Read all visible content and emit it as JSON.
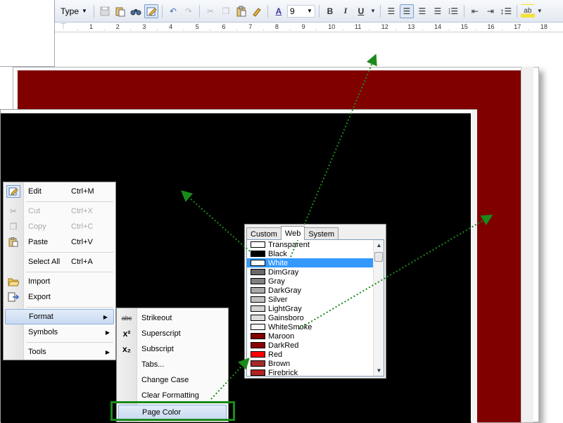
{
  "toolbar": {
    "style_combo": "Type",
    "font_size": "9",
    "icons": [
      "save-icon",
      "paste-special-icon",
      "find-icon",
      "edit-page-icon",
      "undo-icon",
      "redo-icon",
      "cut-icon",
      "copy-icon",
      "paste-icon",
      "format-painter-icon",
      "font-color-icon",
      "bold-icon",
      "italic-icon",
      "underline-icon",
      "align-justify-icon",
      "align-left-icon",
      "align-center-icon",
      "align-right-icon",
      "bullets-icon",
      "decrease-indent-icon",
      "increase-indent-icon",
      "line-spacing-icon",
      "highlight-icon"
    ],
    "bold": "B",
    "italic": "I",
    "underline": "U",
    "font_color_glyph": "A",
    "highlight_glyph": "ab"
  },
  "ruler": {
    "numbers": [
      "1",
      "2",
      "3",
      "4",
      "5",
      "6",
      "7",
      "8",
      "9",
      "10",
      "11",
      "12",
      "13",
      "14",
      "15",
      "16",
      "17",
      "18"
    ]
  },
  "context_menu": {
    "items": [
      {
        "label": "Edit",
        "shortcut": "Ctrl+M",
        "icon": "edit-page-icon",
        "enabled": true
      },
      {
        "label": "Cut",
        "shortcut": "Ctrl+X",
        "icon": "cut-icon",
        "enabled": false
      },
      {
        "label": "Copy",
        "shortcut": "Ctrl+C",
        "icon": "copy-icon",
        "enabled": false
      },
      {
        "label": "Paste",
        "shortcut": "Ctrl+V",
        "icon": "paste-icon",
        "enabled": true
      },
      {
        "label": "Select All",
        "shortcut": "Ctrl+A",
        "enabled": true
      },
      {
        "label": "Import",
        "icon": "open-folder-icon",
        "enabled": true
      },
      {
        "label": "Export",
        "icon": "export-icon",
        "enabled": true
      },
      {
        "label": "Format",
        "submenu": true,
        "highlighted": true
      },
      {
        "label": "Symbols",
        "submenu": true
      },
      {
        "label": "Tools",
        "submenu": true
      }
    ]
  },
  "format_submenu": {
    "items": [
      {
        "label": "Strikeout",
        "icon": "strikeout-icon",
        "glyph": "abc"
      },
      {
        "label": "Superscript",
        "icon": "superscript-icon",
        "glyph": "x²"
      },
      {
        "label": "Subscript",
        "icon": "subscript-icon",
        "glyph": "x₂"
      },
      {
        "label": "Tabs..."
      },
      {
        "label": "Change Case"
      },
      {
        "label": "Clear Formatting"
      },
      {
        "label": "Page Color",
        "highlighted": true
      }
    ]
  },
  "color_picker": {
    "tabs": [
      "Custom",
      "Web",
      "System"
    ],
    "active_tab": "Web",
    "selected": "White",
    "colors": [
      {
        "name": "Transparent",
        "hex": "#ffffff"
      },
      {
        "name": "Black",
        "hex": "#000000"
      },
      {
        "name": "White",
        "hex": "#ffffff"
      },
      {
        "name": "DimGray",
        "hex": "#696969"
      },
      {
        "name": "Gray",
        "hex": "#808080"
      },
      {
        "name": "DarkGray",
        "hex": "#a9a9a9"
      },
      {
        "name": "Silver",
        "hex": "#c0c0c0"
      },
      {
        "name": "LightGray",
        "hex": "#d3d3d3"
      },
      {
        "name": "Gainsboro",
        "hex": "#dcdcdc"
      },
      {
        "name": "WhiteSmoke",
        "hex": "#f5f5f5"
      },
      {
        "name": "Maroon",
        "hex": "#800000"
      },
      {
        "name": "DarkRed",
        "hex": "#8b0000"
      },
      {
        "name": "Red",
        "hex": "#ff0000"
      },
      {
        "name": "Brown",
        "hex": "#a52a2a"
      },
      {
        "name": "Firebrick",
        "hex": "#b22222"
      }
    ]
  },
  "colors": {
    "page_maroon": "#800000",
    "page_black": "#000000",
    "annotation_green": "#1a8a1a",
    "selection_blue": "#3399ff"
  }
}
